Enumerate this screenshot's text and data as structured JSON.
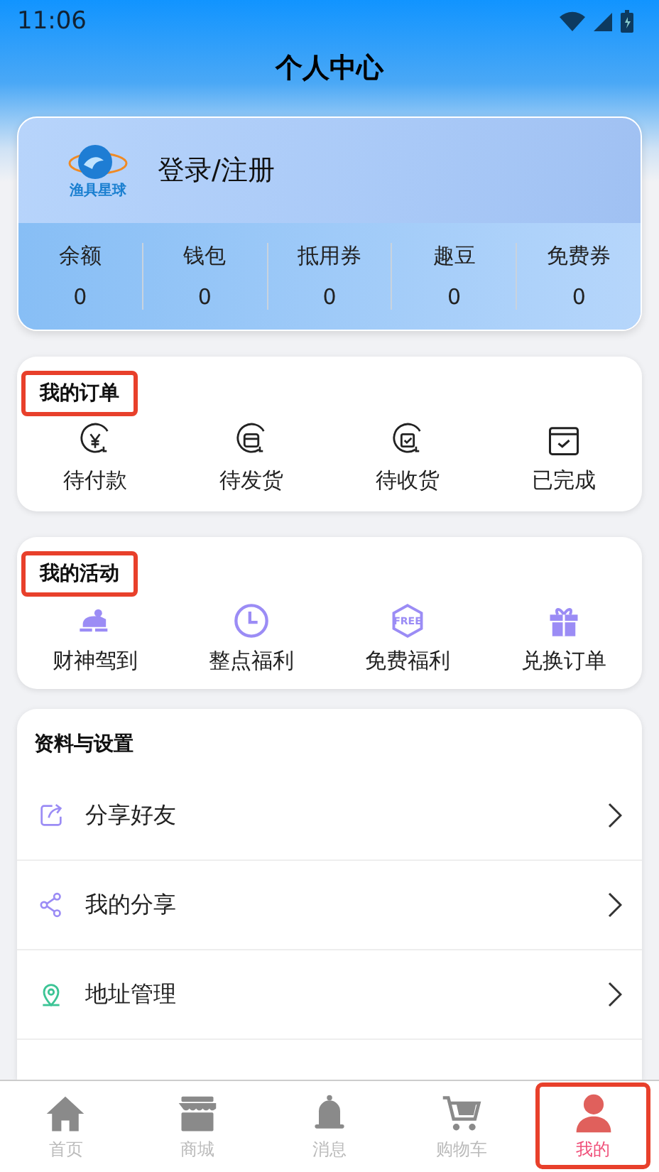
{
  "status_bar": {
    "time": "11:06"
  },
  "title": "个人中心",
  "profile": {
    "logo_text": "渔具星球",
    "login": "登录/注册",
    "stats": [
      {
        "label": "余额",
        "value": "0"
      },
      {
        "label": "钱包",
        "value": "0"
      },
      {
        "label": "抵用券",
        "value": "0"
      },
      {
        "label": "趣豆",
        "value": "0"
      },
      {
        "label": "免费券",
        "value": "0"
      }
    ]
  },
  "orders": {
    "title": "我的订单",
    "highlighted": true,
    "items": [
      {
        "kind": "yen",
        "label": "待付款"
      },
      {
        "kind": "box",
        "label": "待发货"
      },
      {
        "kind": "check",
        "label": "待收货"
      },
      {
        "kind": "done",
        "label": "已完成"
      }
    ]
  },
  "activities": {
    "title": "我的活动",
    "highlighted": true,
    "items": [
      {
        "kind": "car",
        "label": "财神驾到"
      },
      {
        "kind": "clock",
        "label": "整点福利"
      },
      {
        "kind": "free",
        "label": "免费福利",
        "badge": "FREE"
      },
      {
        "kind": "gift",
        "label": "兑换订单"
      }
    ]
  },
  "settings": {
    "title": "资料与设置",
    "items": [
      {
        "kind": "share",
        "label": "分享好友"
      },
      {
        "kind": "nodes",
        "label": "我的分享"
      },
      {
        "kind": "pin",
        "label": "地址管理"
      }
    ]
  },
  "tabbar": [
    {
      "kind": "home",
      "label": "首页",
      "selected": false,
      "highlighted": false
    },
    {
      "kind": "shop",
      "label": "商城",
      "selected": false,
      "highlighted": false
    },
    {
      "kind": "bell",
      "label": "消息",
      "selected": false,
      "highlighted": false
    },
    {
      "kind": "cart",
      "label": "购物车",
      "selected": false,
      "highlighted": false
    },
    {
      "kind": "user",
      "label": "我的",
      "selected": true,
      "highlighted": true
    }
  ]
}
